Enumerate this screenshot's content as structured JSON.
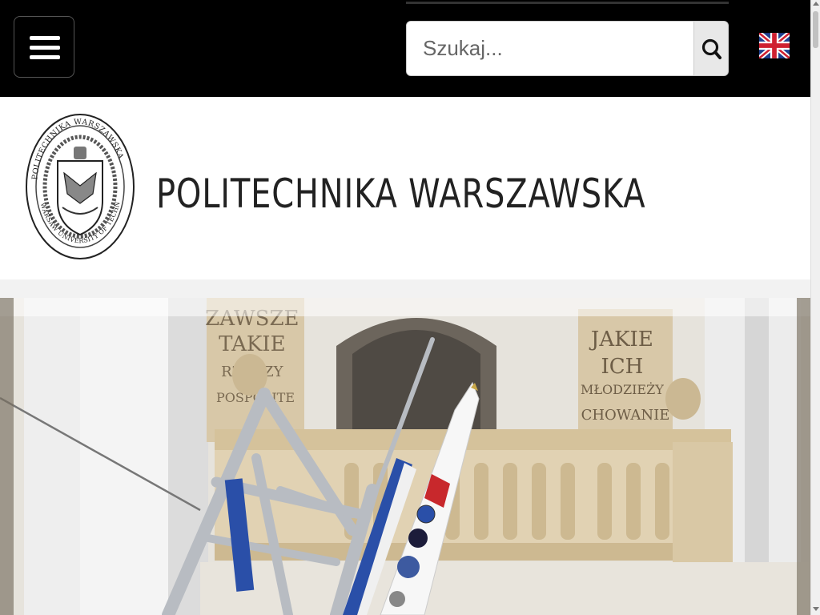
{
  "header": {
    "menu_icon": "hamburger-menu-icon",
    "search": {
      "placeholder": "Szukaj...",
      "value": ""
    },
    "search_icon": "search-icon",
    "language_icon": "uk-flag-icon"
  },
  "brand": {
    "name": "POLITECHNIKA  WARSZAWSKA",
    "logo_icon": "warsaw-university-seal-icon",
    "seal_text_top": "POLITECHNIKA WARSZAWSKA",
    "seal_text_bottom": "WARSAW UNIVERSITY OF TECHNOLOGY"
  },
  "hero": {
    "plaque_left": [
      "ZAWSZE",
      "TAKIE",
      "RZECZY",
      "POSPOLITE"
    ],
    "plaque_right": [
      "JAKIE",
      "ICH",
      "MŁODZIEŻY",
      "CHOWANIE"
    ]
  },
  "colors": {
    "topbar": "#000000",
    "accent_blue": "#2a4fa8",
    "rocket_red": "#c8282c"
  }
}
